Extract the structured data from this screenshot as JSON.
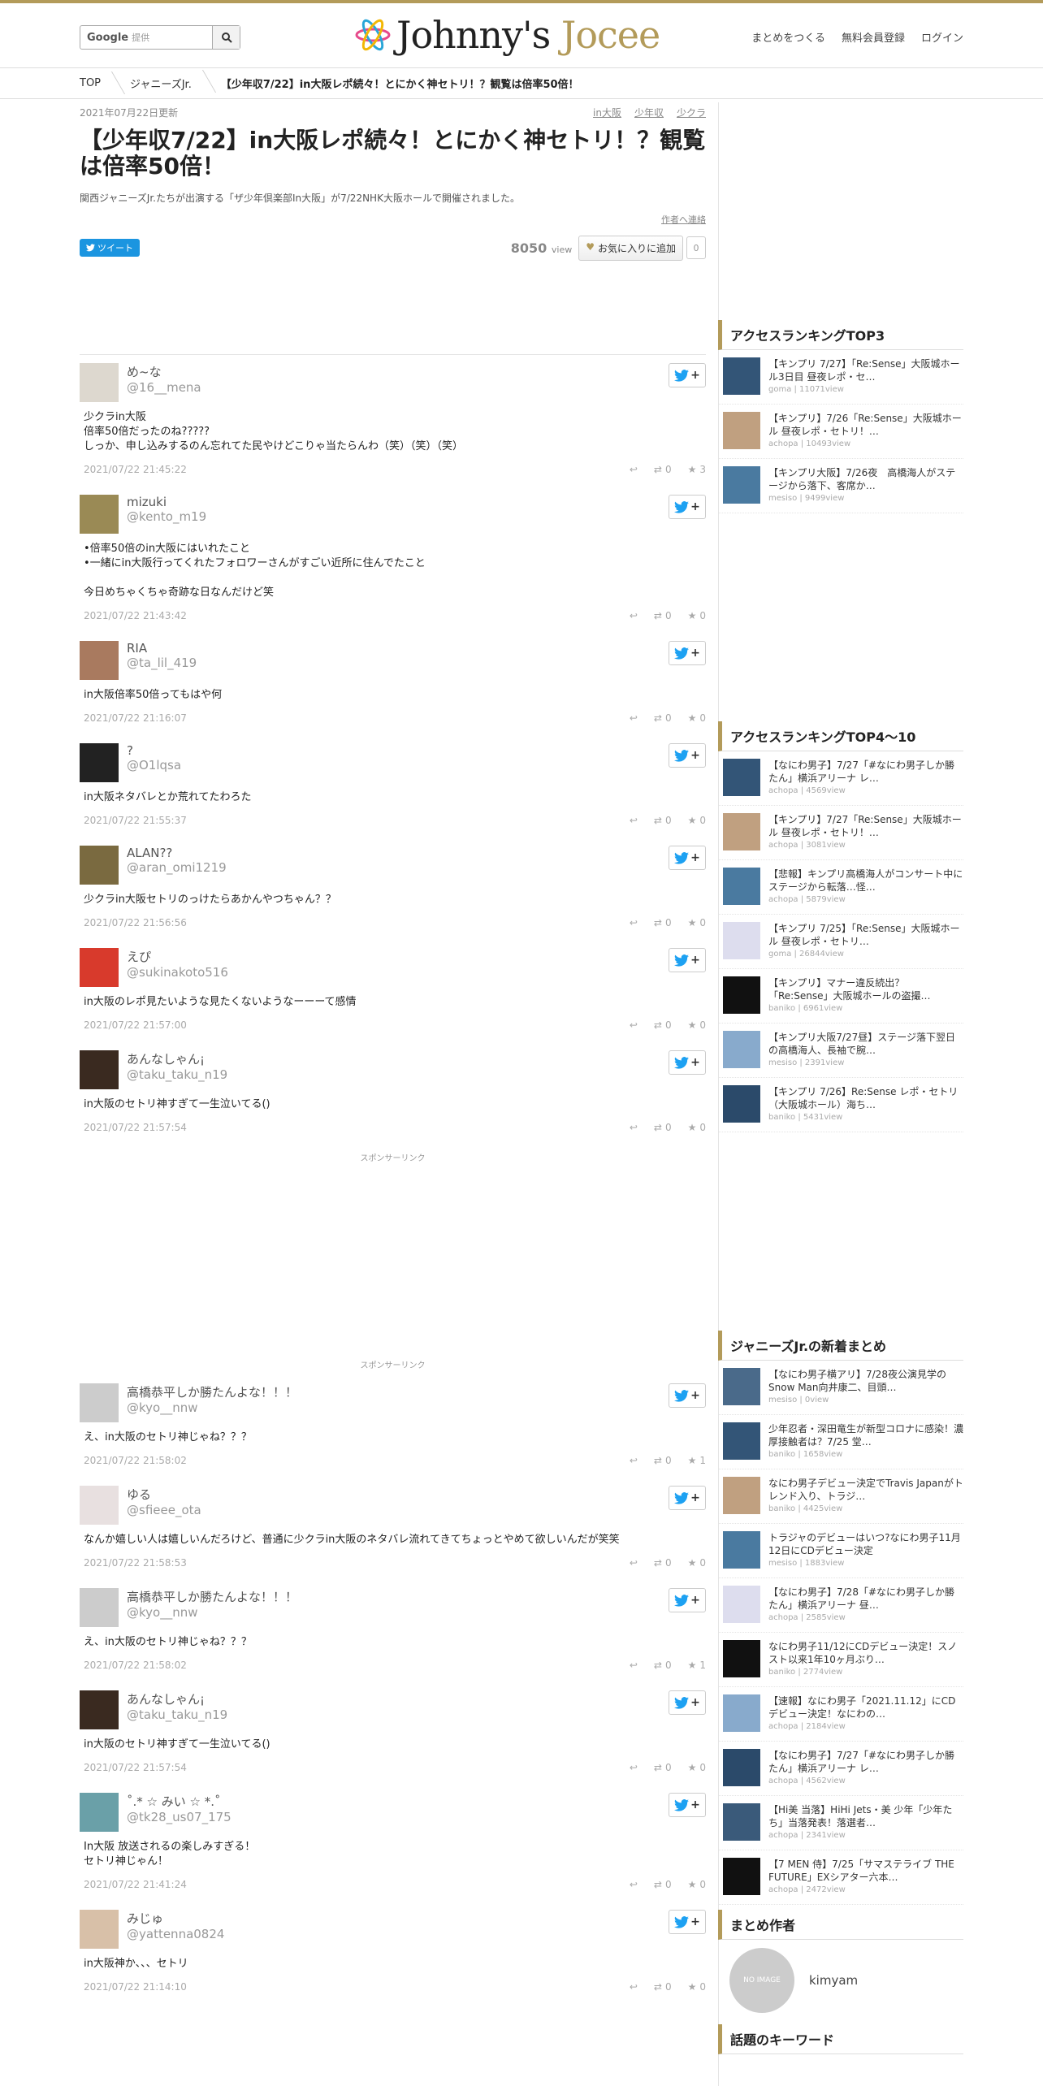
{
  "header": {
    "search_prefix": "Google",
    "search_placeholder": "提供",
    "logo_left": "Johnny's",
    "logo_right": "Jocee",
    "nav": [
      "まとめをつくる",
      "無料会員登録",
      "ログイン"
    ]
  },
  "breadcrumb": [
    "TOP",
    "ジャニーズJr.",
    "【少年収7/22】in大阪レポ続々！とにかく神セトリ！？観覧は倍率50倍！"
  ],
  "article": {
    "updated": "2021年07月22日更新",
    "tags": [
      "in大阪",
      "少年収",
      "少クラ"
    ],
    "title": "【少年収7/22】in大阪レポ続々！とにかく神セトリ！？観覧は倍率50倍！",
    "desc": "関西ジャニーズJr.たちが出演する「ザ少年倶楽部In大阪」が7/22NHK大阪ホールで開催されました。",
    "author_link": "作者へ連絡",
    "tweet_label": "ツイート",
    "views": "8050",
    "views_unit": "view",
    "fav_label": "お気に入りに追加",
    "fav_count": "0",
    "sponsor": "スポンサーリンク"
  },
  "tweets": [
    {
      "name": "め~な",
      "handle": "@16__mena",
      "text": "少クラin大阪\n倍率50倍だったのね?????\nしっか、申し込みするのん忘れてた民やけどこりゃ当たらんわ（笑）（笑）（笑）",
      "date": "2021/07/22 21:45:22",
      "rt": "0",
      "fav": "3"
    },
    {
      "name": "mizuki",
      "handle": "@kento_m19",
      "text": "•倍率50倍のin大阪にはいれたこと\n•一緒にin大阪行ってくれたフォロワーさんがすごい近所に住んでたこと\n\n今日めちゃくちゃ奇跡な日なんだけど笑",
      "date": "2021/07/22 21:43:42",
      "rt": "0",
      "fav": "0"
    },
    {
      "name": "RIA",
      "handle": "@ta_lil_419",
      "text": "in大阪倍率50倍ってもはや何",
      "date": "2021/07/22 21:16:07",
      "rt": "0",
      "fav": "0"
    },
    {
      "name": "?",
      "handle": "@O1lqsa",
      "text": "in大阪ネタバレとか荒れてたわろた",
      "date": "2021/07/22 21:55:37",
      "rt": "0",
      "fav": "0"
    },
    {
      "name": "ALAN??",
      "handle": "@aran_omi1219",
      "text": "少クラin大阪セトリのっけたらあかんやつちゃん？？",
      "date": "2021/07/22 21:56:56",
      "rt": "0",
      "fav": "0"
    },
    {
      "name": "えぴ",
      "handle": "@sukinakoto516",
      "text": "in大阪のレポ見たいような見たくないようなーーーて感情",
      "date": "2021/07/22 21:57:00",
      "rt": "0",
      "fav": "0"
    },
    {
      "name": "あんなしゃん¡",
      "handle": "@taku_taku_n19",
      "text": "in大阪のセトリ神すぎて一生泣いてる()",
      "date": "2021/07/22 21:57:54",
      "rt": "0",
      "fav": "0"
    },
    {
      "name": "高橋恭平しか勝たんよな！！！",
      "handle": "@kyo__nnw",
      "text": "え、in大阪のセトリ神じゃね？？？",
      "date": "2021/07/22 21:58:02",
      "rt": "0",
      "fav": "1"
    },
    {
      "name": "ゆる",
      "handle": "@sfieee_ota",
      "text": "なんか嬉しい人は嬉しいんだろけど、普通に少クラin大阪のネタバレ流れてきてちょっとやめて欲しいんだが笑笑",
      "date": "2021/07/22 21:58:53",
      "rt": "0",
      "fav": "0"
    },
    {
      "name": "高橋恭平しか勝たんよな！！！",
      "handle": "@kyo__nnw",
      "text": "え、in大阪のセトリ神じゃね？？？",
      "date": "2021/07/22 21:58:02",
      "rt": "0",
      "fav": "1"
    },
    {
      "name": "あんなしゃん¡",
      "handle": "@taku_taku_n19",
      "text": "in大阪のセトリ神すぎて一生泣いてる()",
      "date": "2021/07/22 21:57:54",
      "rt": "0",
      "fav": "0"
    },
    {
      "name": "˚.* ☆ みい ☆ *.˚",
      "handle": "@tk28_us07_175",
      "text": "In大阪 放送されるの楽しみすぎる！\nセトリ神じゃん！",
      "date": "2021/07/22 21:41:24",
      "rt": "0",
      "fav": "0"
    },
    {
      "name": "みじゅ",
      "handle": "@yattenna0824",
      "text": "in大阪神か、、、セトリ",
      "date": "2021/07/22 21:14:10",
      "rt": "0",
      "fav": "0"
    }
  ],
  "sidebar": {
    "top3_title": "アクセスランキングTOP3",
    "top3": [
      {
        "title": "【キンプリ 7/27】「Re:Sense」大阪城ホール3日目 昼夜レポ・セ…",
        "sub": "goma | 11071view"
      },
      {
        "title": "【キンプリ】7/26「Re:Sense」大阪城ホール 昼夜レポ・セトリ！…",
        "sub": "achopa | 10493view"
      },
      {
        "title": "【キンプリ大阪】7/26夜　高橋海人がステージから落下、客席か…",
        "sub": "mesiso | 9499view"
      }
    ],
    "top4_title": "アクセスランキングTOP4～10",
    "top4": [
      {
        "title": "【なにわ男子】7/27「#なにわ男子しか勝たん」横浜アリーナ レ…",
        "sub": "achopa | 4569view"
      },
      {
        "title": "【キンプリ】7/27「Re:Sense」大阪城ホール 昼夜レポ・セトリ！…",
        "sub": "achopa | 3081view"
      },
      {
        "title": "【悲報】キンプリ高橋海人がコンサート中にステージから転落…怪…",
        "sub": "achopa | 5879view"
      },
      {
        "title": "【キンプリ 7/25】「Re:Sense」大阪城ホール 昼夜レポ・セトリ…",
        "sub": "goma | 26844view"
      },
      {
        "title": "【キンプリ】マナー違反続出？「Re:Sense」大阪城ホールの盗撮…",
        "sub": "baniko | 6961view"
      },
      {
        "title": "【キンプリ大阪7/27昼】ステージ落下翌日の高橋海人、長袖で腕…",
        "sub": "mesiso | 2391view"
      },
      {
        "title": "【キンプリ 7/26】Re:Sense レポ・セトリ（大阪城ホール）海ち…",
        "sub": "baniko | 5431view"
      }
    ],
    "new_title": "ジャニーズJr.の新着まとめ",
    "new": [
      {
        "title": "【なにわ男子横アリ】7/28夜公演見学のSnow Man向井康二、目頭…",
        "sub": "mesiso | 0view"
      },
      {
        "title": "少年忍者・深田竜生が新型コロナに感染！濃厚接触者は？7/25 堂…",
        "sub": "baniko | 1658view"
      },
      {
        "title": "なにわ男子デビュー決定でTravis Japanがトレンド入り、トラジ…",
        "sub": "baniko | 4425view"
      },
      {
        "title": "トラジャのデビューはいつ?なにわ男子11月12日にCDデビュー決定",
        "sub": "mesiso | 1883view"
      },
      {
        "title": "【なにわ男子】7/28「#なにわ男子しか勝たん」横浜アリーナ 昼…",
        "sub": "achopa | 2585view"
      },
      {
        "title": "なにわ男子11/12にCDデビュー決定！スノスト以来1年10ヶ月ぶり…",
        "sub": "baniko | 2774view"
      },
      {
        "title": "【速報】なにわ男子「2021.11.12」にCDデビュー決定！なにわの…",
        "sub": "achopa | 2184view"
      },
      {
        "title": "【なにわ男子】7/27「#なにわ男子しか勝たん」横浜アリーナ レ…",
        "sub": "achopa | 4562view"
      },
      {
        "title": "【Hi美 当落】HiHi Jets・美 少年「少年たち」当落発表！落選者…",
        "sub": "achopa | 2341view"
      },
      {
        "title": "【7 MEN 侍】7/25「サマステライブ THE FUTURE」EXシアター六本…",
        "sub": "achopa | 2472view"
      }
    ],
    "author_title": "まとめ作者",
    "author_noimage": "NO IMAGE",
    "author_name": "kimyam",
    "keyword_title": "話題のキーワード"
  },
  "colors": {
    "gold": "#b39b5a",
    "twitter": "#1da1f2"
  }
}
